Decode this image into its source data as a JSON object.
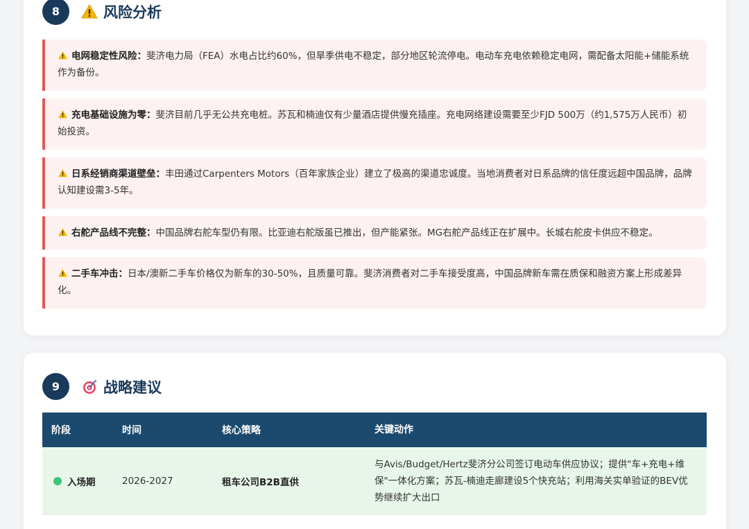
{
  "risk_section": {
    "number": "8",
    "title": "风险分析",
    "icon": "warning-icon",
    "items": [
      {
        "label": "电网稳定性风险：",
        "text": "斐济电力局（FEA）水电占比约60%，但旱季供电不稳定，部分地区轮流停电。电动车充电依赖稳定电网，需配备太阳能+储能系统作为备份。"
      },
      {
        "label": "充电基础设施为零：",
        "text": "斐济目前几乎无公共充电桩。苏瓦和楠迪仅有少量酒店提供慢充插座。充电网络建设需要至少FJD 500万（约1,575万人民币）初始投资。"
      },
      {
        "label": "日系经销商渠道壁垒：",
        "text": "丰田通过Carpenters Motors（百年家族企业）建立了极高的渠道忠诚度。当地消费者对日系品牌的信任度远超中国品牌，品牌认知建设需3-5年。"
      },
      {
        "label": "右舵产品线不完整：",
        "text": "中国品牌右舵车型仍有限。比亚迪右舵版虽已推出，但产能紧张。MG右舵产品线正在扩展中。长城右舵皮卡供应不稳定。"
      },
      {
        "label": "二手车冲击：",
        "text": "日本/澳新二手车价格仅为新车的30-50%，且质量可靠。斐济消费者对二手车接受度高，中国品牌新车需在质保和融资方案上形成差异化。"
      }
    ]
  },
  "strategy_section": {
    "number": "9",
    "title": "战略建议",
    "icon": "target-icon",
    "headers": [
      "阶段",
      "时间",
      "核心策略",
      "关键动作"
    ],
    "rows": [
      {
        "phase": "入场期",
        "time": "2026-2027",
        "strategy": "租车公司B2B直供",
        "actions": "与Avis/Budget/Hertz斐济分公司签订电动车供应协议；提供\"车+充电+维保\"一体化方案；苏瓦-楠迪走廊建设5个快充站；利用海关实单验证的BEV优势继续扩大出口",
        "status_color": "#3cc67a"
      }
    ]
  },
  "colors": {
    "navy": "#1a3a5c",
    "table_header": "#1b4a6e",
    "risk_bg": "#fdf1f1",
    "risk_border": "#e05a5a",
    "row_bg": "#e8f6ea"
  }
}
